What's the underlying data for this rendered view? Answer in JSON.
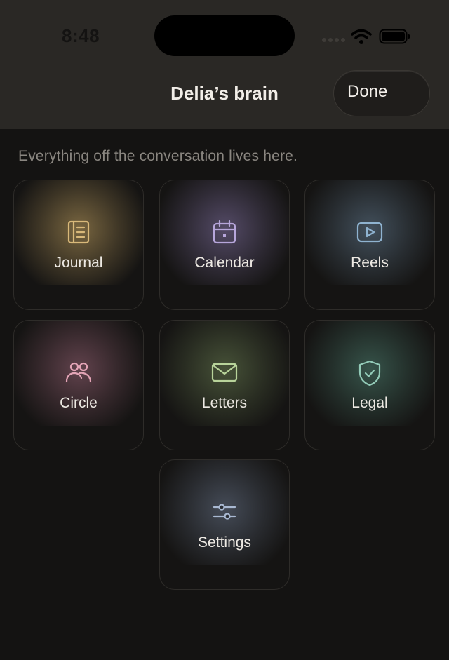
{
  "status": {
    "time": "8:48"
  },
  "header": {
    "title": "Delia’s brain",
    "done_label": "Done"
  },
  "subtitle": "Everything off the conversation lives here.",
  "tiles": [
    {
      "label": "Journal",
      "icon": "journal-icon",
      "color": "#D9B97A",
      "glow": "#8A7448"
    },
    {
      "label": "Calendar",
      "icon": "calendar-icon",
      "color": "#B7A6DB",
      "glow": "#5F5475"
    },
    {
      "label": "Reels",
      "icon": "play-icon",
      "color": "#8FB3D0",
      "glow": "#4A5A68"
    },
    {
      "label": "Circle",
      "icon": "people-icon",
      "color": "#E3A4B6",
      "glow": "#6E4A56"
    },
    {
      "label": "Letters",
      "icon": "envelope-icon",
      "color": "#B8D39A",
      "glow": "#4F5C3E"
    },
    {
      "label": "Legal",
      "icon": "shield-check-icon",
      "color": "#93CBB8",
      "glow": "#3C5E53"
    },
    {
      "label": "Settings",
      "icon": "sliders-icon",
      "color": "#A9B9D2",
      "glow": "#4D5563"
    }
  ]
}
